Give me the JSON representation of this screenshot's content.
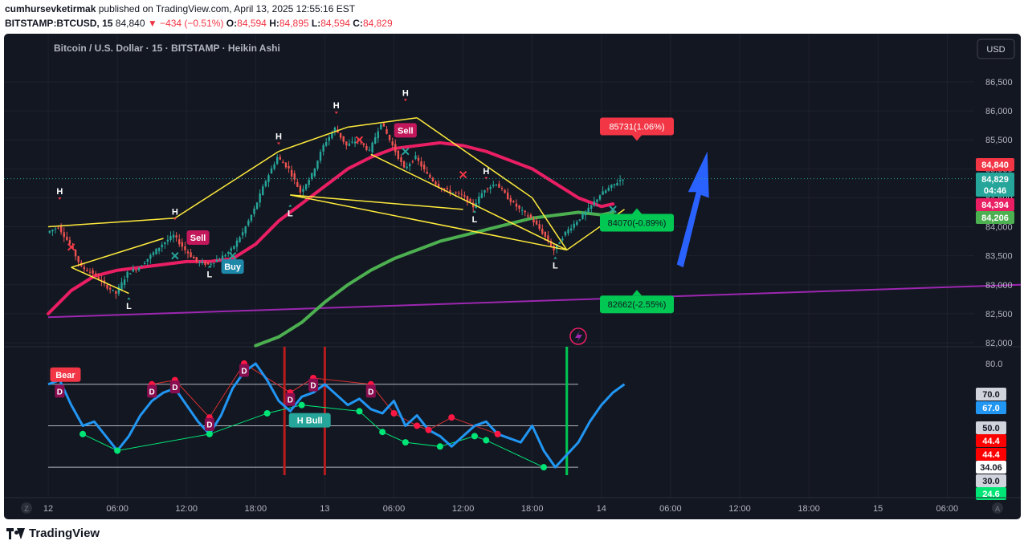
{
  "header": {
    "author": "cumhursevketirmak",
    "published_text": "published on TradingView.com, April 13, 2025 12:55:16 EST",
    "symbol": "BITSTAMP:BTCUSD, 15",
    "price": "84,840",
    "change": "▼ −434 (−0.51%)",
    "o_label": "O:",
    "o_value": "84,594",
    "h_label": "H:",
    "h_value": "84,895",
    "l_label": "L:",
    "l_value": "84,594",
    "c_label": "C:",
    "c_value": "84,829"
  },
  "footer": {
    "brand": "TradingView"
  },
  "colors": {
    "background": "#131722",
    "up": "#26a69a",
    "down": "#ef5350",
    "ema_fast": "#e91e63",
    "ema_slow": "#4caf50",
    "trend": "#9c27b0",
    "zigzag": "#ffeb3b",
    "rsi": "#2196f3"
  },
  "chart_data": [
    {
      "type": "candlestick",
      "title": "Bitcoin / U.S. Dollar · 15 · BITSTAMP · Heikin Ashi",
      "currency_button": "USD",
      "ylim": [
        81900,
        86900
      ],
      "yticks": [
        82000,
        82500,
        83000,
        83500,
        84000,
        84500,
        85000,
        85500,
        86000,
        86500
      ],
      "ytick_labels": [
        "82,000",
        "82,500",
        "83,000",
        "83,500",
        "84,000",
        "84,500",
        "85,000",
        "85,500",
        "86,000",
        "86,500"
      ],
      "xlim": [
        0,
        134
      ],
      "xtick_labels": [
        {
          "x": 0,
          "label": "12"
        },
        {
          "x": 6,
          "label": "06:00"
        },
        {
          "x": 12,
          "label": "12:00"
        },
        {
          "x": 18,
          "label": "18:00"
        },
        {
          "x": 24,
          "label": "13"
        },
        {
          "x": 30,
          "label": "06:00"
        },
        {
          "x": 36,
          "label": "12:00"
        },
        {
          "x": 42,
          "label": "18:00"
        },
        {
          "x": 48,
          "label": "14"
        },
        {
          "x": 54,
          "label": "06:00"
        },
        {
          "x": 60,
          "label": "12:00"
        },
        {
          "x": 66,
          "label": "18:00"
        },
        {
          "x": 72,
          "label": "15"
        },
        {
          "x": 78,
          "label": "06:00"
        }
      ],
      "price_path": [
        [
          0,
          83900
        ],
        [
          1,
          84000
        ],
        [
          2,
          83700
        ],
        [
          3,
          83300
        ],
        [
          4,
          83200
        ],
        [
          5,
          83000
        ],
        [
          6,
          82850
        ],
        [
          7,
          83200
        ],
        [
          8,
          83300
        ],
        [
          9,
          83500
        ],
        [
          10,
          83700
        ],
        [
          11,
          83850
        ],
        [
          12,
          83600
        ],
        [
          13,
          83400
        ],
        [
          14,
          83350
        ],
        [
          15,
          83450
        ],
        [
          16,
          83600
        ],
        [
          17,
          83900
        ],
        [
          18,
          84300
        ],
        [
          19,
          84800
        ],
        [
          20,
          85200
        ],
        [
          21,
          85000
        ],
        [
          22,
          84600
        ],
        [
          23,
          84900
        ],
        [
          24,
          85400
        ],
        [
          25,
          85700
        ],
        [
          26,
          85400
        ],
        [
          27,
          85500
        ],
        [
          28,
          85300
        ],
        [
          29,
          85800
        ],
        [
          30,
          85400
        ],
        [
          31,
          85000
        ],
        [
          32,
          85200
        ],
        [
          33,
          84900
        ],
        [
          34,
          84700
        ],
        [
          35,
          84600
        ],
        [
          36,
          84550
        ],
        [
          37,
          84350
        ],
        [
          38,
          84650
        ],
        [
          39,
          84750
        ],
        [
          40,
          84500
        ],
        [
          41,
          84300
        ],
        [
          42,
          84150
        ],
        [
          43,
          83900
        ],
        [
          44,
          83600
        ],
        [
          45,
          83900
        ],
        [
          46,
          84100
        ],
        [
          47,
          84300
        ],
        [
          48,
          84550
        ],
        [
          49,
          84700
        ],
        [
          50,
          84840
        ]
      ],
      "candle_count": 200,
      "last_candle_x": 50,
      "series": [
        {
          "name": "ema_fast",
          "color": "#e91e63",
          "values": [
            [
              0,
              82500
            ],
            [
              2,
              82900
            ],
            [
              4,
              83150
            ],
            [
              6,
              83250
            ],
            [
              8,
              83300
            ],
            [
              10,
              83350
            ],
            [
              12,
              83400
            ],
            [
              14,
              83400
            ],
            [
              16,
              83450
            ],
            [
              18,
              83700
            ],
            [
              20,
              84100
            ],
            [
              22,
              84400
            ],
            [
              24,
              84700
            ],
            [
              26,
              85000
            ],
            [
              28,
              85200
            ],
            [
              30,
              85350
            ],
            [
              32,
              85400
            ],
            [
              34,
              85450
            ],
            [
              36,
              85400
            ],
            [
              38,
              85300
            ],
            [
              40,
              85150
            ],
            [
              42,
              85000
            ],
            [
              44,
              84750
            ],
            [
              46,
              84500
            ],
            [
              48,
              84350
            ],
            [
              49,
              84394
            ]
          ]
        },
        {
          "name": "ema_slow",
          "color": "#4caf50",
          "values": [
            [
              18,
              81950
            ],
            [
              20,
              82100
            ],
            [
              22,
              82350
            ],
            [
              24,
              82700
            ],
            [
              26,
              83000
            ],
            [
              28,
              83250
            ],
            [
              30,
              83450
            ],
            [
              32,
              83600
            ],
            [
              34,
              83750
            ],
            [
              36,
              83850
            ],
            [
              38,
              83950
            ],
            [
              40,
              84050
            ],
            [
              42,
              84150
            ],
            [
              44,
              84200
            ],
            [
              46,
              84250
            ],
            [
              48,
              84206
            ],
            [
              49,
              84250
            ]
          ]
        },
        {
          "name": "trendline",
          "color": "#9c27b0",
          "values": [
            [
              0,
              82440
            ],
            [
              80,
              83000
            ]
          ]
        }
      ],
      "zigzag": [
        {
          "from": [
            0,
            84000
          ],
          "to": [
            11,
            84150
          ]
        },
        {
          "from": [
            11,
            84150
          ],
          "to": [
            20,
            85300
          ]
        },
        {
          "from": [
            20,
            85300
          ],
          "to": [
            26,
            85720
          ]
        },
        {
          "from": [
            26,
            85720
          ],
          "to": [
            32,
            85880
          ]
        },
        {
          "from": [
            32,
            85880
          ],
          "to": [
            42,
            84500
          ]
        },
        {
          "from": [
            42,
            84500
          ],
          "to": [
            45,
            83600
          ]
        },
        {
          "from": [
            2,
            83300
          ],
          "to": [
            10,
            83800
          ]
        },
        {
          "from": [
            2,
            83300
          ],
          "to": [
            7,
            82850
          ]
        },
        {
          "from": [
            21,
            84550
          ],
          "to": [
            36,
            84300
          ]
        },
        {
          "from": [
            21,
            84550
          ],
          "to": [
            45,
            83600
          ]
        },
        {
          "from": [
            28,
            85250
          ],
          "to": [
            45,
            83600
          ]
        },
        {
          "from": [
            45,
            83600
          ],
          "to": [
            50,
            84300
          ]
        }
      ],
      "hl_labels": [
        {
          "x": 1,
          "y": 84450,
          "text": "H",
          "pos": "above"
        },
        {
          "x": 7,
          "y": 82800,
          "text": "L",
          "pos": "below"
        },
        {
          "x": 11,
          "y": 84100,
          "text": "H",
          "pos": "above"
        },
        {
          "x": 14,
          "y": 83350,
          "text": "L",
          "pos": "below"
        },
        {
          "x": 20,
          "y": 85400,
          "text": "H",
          "pos": "above"
        },
        {
          "x": 21,
          "y": 84400,
          "text": "L",
          "pos": "below"
        },
        {
          "x": 25,
          "y": 85930,
          "text": "H",
          "pos": "above"
        },
        {
          "x": 31,
          "y": 86150,
          "text": "H",
          "pos": "above"
        },
        {
          "x": 37,
          "y": 84300,
          "text": "L",
          "pos": "below"
        },
        {
          "x": 38,
          "y": 84800,
          "text": "H",
          "pos": "above"
        },
        {
          "x": 44,
          "y": 83500,
          "text": "L",
          "pos": "below"
        }
      ],
      "signals": [
        {
          "x": 13,
          "y": 83800,
          "text": "Sell",
          "color": "#c2185b"
        },
        {
          "x": 16,
          "y": 83300,
          "text": "Buy",
          "color": "#1e88a8"
        },
        {
          "x": 31,
          "y": 85650,
          "text": "Sell",
          "color": "#c2185b"
        }
      ],
      "crosses": [
        {
          "x": 2,
          "y": 83650,
          "color": "#f23645"
        },
        {
          "x": 11,
          "y": 83500,
          "color": "#26a69a"
        },
        {
          "x": 16,
          "y": 83500,
          "color": "#26a69a"
        },
        {
          "x": 27,
          "y": 85500,
          "color": "#f23645"
        },
        {
          "x": 31,
          "y": 85300,
          "color": "#26a69a"
        },
        {
          "x": 36,
          "y": 84900,
          "color": "#f23645"
        },
        {
          "x": 49,
          "y": 84300,
          "color": "#26a69a"
        }
      ],
      "targets": [
        {
          "x": 56,
          "y": 85731,
          "text": "85731(1.06%)",
          "color": "#f23645",
          "arrow": "down"
        },
        {
          "x": 56,
          "y": 84070,
          "text": "84070(-0.89%)",
          "color": "#00c853",
          "arrow": "up"
        },
        {
          "x": 56,
          "y": 82662,
          "text": "82662(-2.55%)",
          "color": "#00c853",
          "arrow": "up"
        }
      ],
      "price_labels": [
        {
          "y": 84840,
          "text": "84,840",
          "color": "#f23645"
        },
        {
          "y": 84829,
          "text": "84,829",
          "color": "#26a69a"
        },
        {
          "y": 84829,
          "text": "04:46",
          "color": "#26a69a"
        },
        {
          "y": 84394,
          "text": "84,394",
          "color": "#e91e63"
        },
        {
          "y": 84206,
          "text": "84,206",
          "color": "#4caf50"
        }
      ]
    },
    {
      "type": "line",
      "name": "rsi_panel",
      "ylim": [
        20,
        85
      ],
      "yticks": [
        80.0
      ],
      "ytick_labels": [
        "80.0"
      ],
      "levels": [
        70,
        50,
        30
      ],
      "rsi": [
        [
          0,
          70
        ],
        [
          1,
          72
        ],
        [
          2,
          60
        ],
        [
          3,
          50
        ],
        [
          4,
          52
        ],
        [
          5,
          45
        ],
        [
          6,
          38
        ],
        [
          7,
          45
        ],
        [
          8,
          55
        ],
        [
          9,
          62
        ],
        [
          10,
          66
        ],
        [
          11,
          68
        ],
        [
          12,
          60
        ],
        [
          13,
          52
        ],
        [
          14,
          46
        ],
        [
          15,
          55
        ],
        [
          16,
          68
        ],
        [
          17,
          76
        ],
        [
          18,
          80
        ],
        [
          19,
          72
        ],
        [
          20,
          62
        ],
        [
          21,
          57
        ],
        [
          22,
          64
        ],
        [
          23,
          66
        ],
        [
          24,
          70
        ],
        [
          25,
          65
        ],
        [
          26,
          60
        ],
        [
          27,
          63
        ],
        [
          28,
          58
        ],
        [
          29,
          56
        ],
        [
          30,
          62
        ],
        [
          31,
          50
        ],
        [
          32,
          55
        ],
        [
          33,
          48
        ],
        [
          34,
          45
        ],
        [
          35,
          40
        ],
        [
          36,
          45
        ],
        [
          37,
          50
        ],
        [
          38,
          52
        ],
        [
          39,
          46
        ],
        [
          40,
          44
        ],
        [
          41,
          42
        ],
        [
          42,
          50
        ],
        [
          43,
          38
        ],
        [
          44,
          30
        ],
        [
          45,
          36
        ],
        [
          46,
          42
        ],
        [
          47,
          52
        ],
        [
          48,
          60
        ],
        [
          49,
          66
        ],
        [
          50,
          70
        ]
      ],
      "divergence_labels": [
        {
          "x": 0.8,
          "y": 70,
          "text": "Bear",
          "color": "#f23645"
        },
        {
          "x": 22,
          "y": 48,
          "text": "H Bull",
          "color": "#26a69a"
        }
      ],
      "d_markers": [
        [
          1,
          69
        ],
        [
          9,
          69
        ],
        [
          11,
          71
        ],
        [
          14,
          53
        ],
        [
          17,
          79
        ],
        [
          21,
          65
        ],
        [
          23,
          72
        ],
        [
          28,
          69
        ]
      ],
      "red_dots": [
        [
          9,
          70
        ],
        [
          11,
          72
        ],
        [
          14,
          54
        ],
        [
          17,
          80
        ],
        [
          21,
          66
        ],
        [
          23,
          73
        ],
        [
          28,
          70
        ],
        [
          30,
          56
        ],
        [
          32,
          50
        ],
        [
          33,
          48
        ],
        [
          35,
          54
        ],
        [
          39,
          46
        ]
      ],
      "green_dots": [
        [
          3,
          46
        ],
        [
          6,
          38
        ],
        [
          14,
          46
        ],
        [
          19,
          56
        ],
        [
          22,
          60
        ],
        [
          27,
          57
        ],
        [
          29,
          47
        ],
        [
          31,
          42
        ],
        [
          34,
          40
        ],
        [
          37,
          45
        ],
        [
          38,
          43
        ],
        [
          43,
          30
        ]
      ],
      "vlines": [
        {
          "x": 20.5,
          "color": "#b71c1c"
        },
        {
          "x": 24,
          "color": "#b71c1c"
        },
        {
          "x": 45,
          "color": "#00c853"
        }
      ],
      "right_labels": [
        {
          "y": 70,
          "text": "70.0",
          "color": "#d1d4dc",
          "dark_text": true
        },
        {
          "y": 67,
          "text": "67.0",
          "color": "#2196f3"
        },
        {
          "y": 50,
          "text": "50.0",
          "color": "#d1d4dc",
          "dark_text": true
        },
        {
          "y": 44.4,
          "text": "44.4",
          "color": "#ff0000"
        },
        {
          "y": 44.4,
          "text": "44.4",
          "color": "#ff0000"
        },
        {
          "y": 34.06,
          "text": "34.06",
          "color": "#ffffff",
          "dark_text": true
        },
        {
          "y": 30,
          "text": "30.0",
          "color": "#d1d4dc",
          "dark_text": true
        },
        {
          "y": 24.6,
          "text": "24.6",
          "color": "#00e676"
        }
      ]
    }
  ]
}
